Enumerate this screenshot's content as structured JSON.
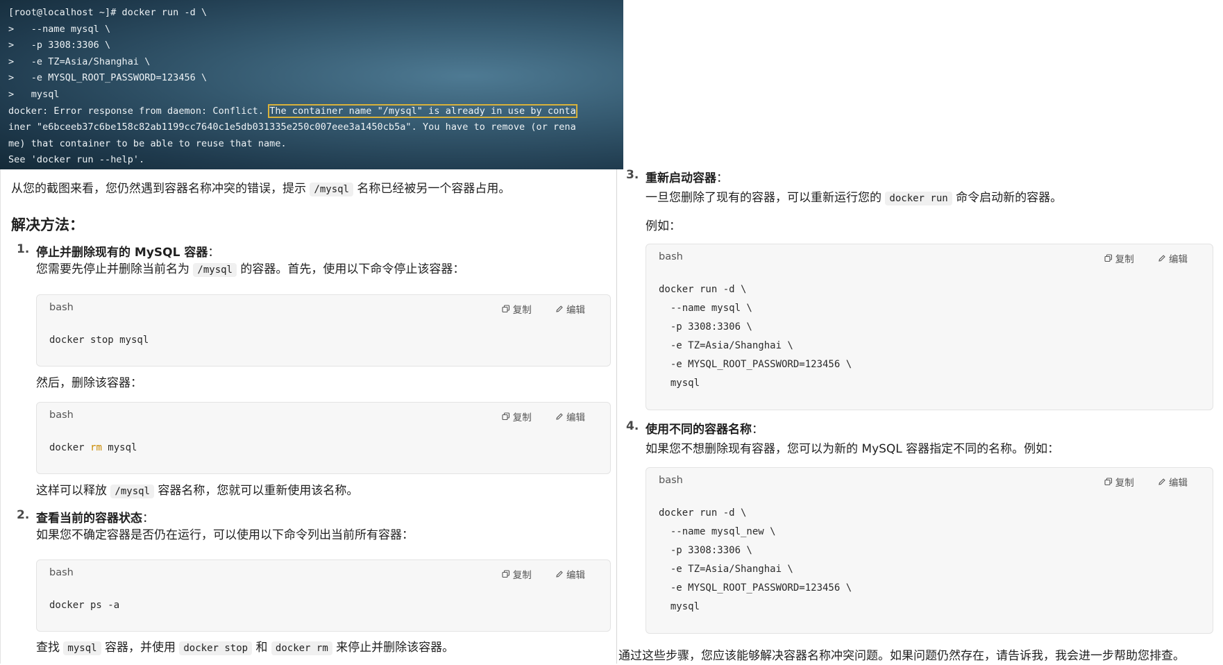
{
  "terminal": {
    "lines": [
      "[root@localhost ~]# docker run -d \\",
      ">   --name mysql \\",
      ">   -p 3308:3306 \\",
      ">   -e TZ=Asia/Shanghai \\",
      ">   -e MYSQL_ROOT_PASSWORD=123456 \\",
      ">   mysql"
    ],
    "error_prefix": "docker: Error response from daemon: Conflict. ",
    "error_highlight": "The container name \"/mysql\" is already in use by conta",
    "error_line2": "iner \"e6bceeb37c6be158c82ab1199cc7640c1e5db031335e250c007eee3a1450cb5a\". You have to remove (or rena",
    "error_line3": "me) that container to be able to reuse that name.",
    "error_line4": "See 'docker run --help'."
  },
  "intro": {
    "before": "从您的截图来看，您仍然遇到容器名称冲突的错误，提示 ",
    "code": "/mysql",
    "after": " 名称已经被另一个容器占用。"
  },
  "solution_heading": "解决方法：",
  "codeblock_labels": {
    "lang": "bash",
    "copy": "复制",
    "edit": "编辑"
  },
  "step1": {
    "num": "1.",
    "title": "停止并删除现有的 MySQL 容器",
    "colon": "：",
    "desc_before": "您需要先停止并删除当前名为 ",
    "desc_code": "/mysql",
    "desc_after": " 的容器。首先，使用以下命令停止该容器：",
    "cmd1": "docker stop mysql",
    "then": "然后，删除该容器：",
    "cmd2_a": "docker ",
    "cmd2_kw": "rm",
    "cmd2_b": " mysql",
    "note_before": "这样可以释放 ",
    "note_code": "/mysql",
    "note_after": " 容器名称，您就可以重新使用该名称。"
  },
  "step2": {
    "num": "2.",
    "title": "查看当前的容器状态",
    "colon": "：",
    "desc": "如果您不确定容器是否仍在运行，可以使用以下命令列出当前所有容器：",
    "cmd": "docker ps -a",
    "note_a": "查找 ",
    "note_code1": "mysql",
    "note_b": " 容器，并使用 ",
    "note_code2": "docker stop",
    "note_c": " 和 ",
    "note_code3": "docker rm",
    "note_d": " 来停止并删除该容器。"
  },
  "step3": {
    "num": "3.",
    "title": "重新启动容器",
    "colon": "：",
    "desc_before": "一旦您删除了现有的容器，可以重新运行您的 ",
    "desc_code": "docker run",
    "desc_after": " 命令启动新的容器。",
    "example": "例如：",
    "cmd": "docker run -d \\\n  --name mysql \\\n  -p 3308:3306 \\\n  -e TZ=Asia/Shanghai \\\n  -e MYSQL_ROOT_PASSWORD=123456 \\\n  mysql"
  },
  "step4": {
    "num": "4.",
    "title": "使用不同的容器名称",
    "colon": "：",
    "desc": "如果您不想删除现有容器，您可以为新的 MySQL 容器指定不同的名称。例如：",
    "cmd": "docker run -d \\\n  --name mysql_new \\\n  -p 3308:3306 \\\n  -e TZ=Asia/Shanghai \\\n  -e MYSQL_ROOT_PASSWORD=123456 \\\n  mysql"
  },
  "conclusion": "通过这些步骤，您应该能够解决容器名称冲突问题。如果问题仍然存在，请告诉我，我会进一步帮助您排查。"
}
